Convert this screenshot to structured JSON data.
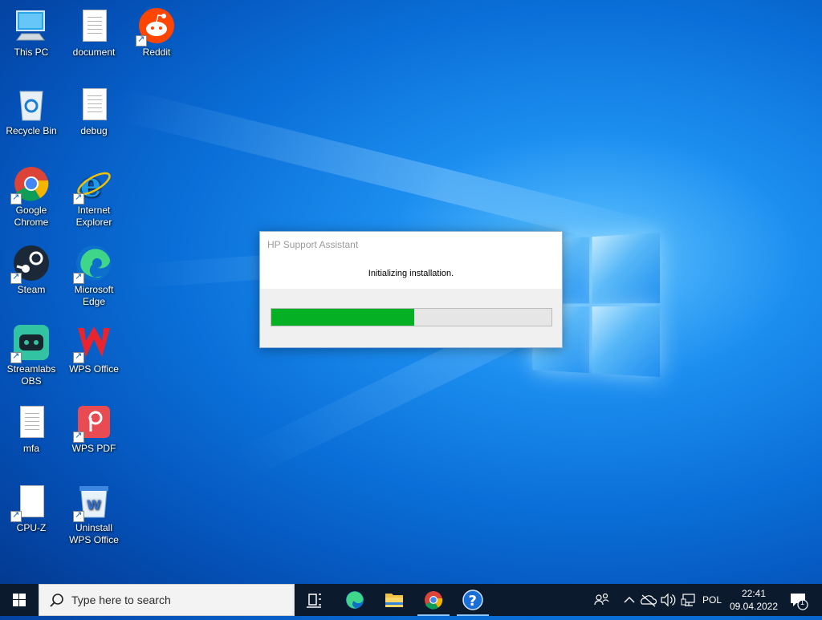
{
  "desktop": {
    "icons": [
      {
        "label": "This PC"
      },
      {
        "label": "document"
      },
      {
        "label": "Reddit"
      },
      {
        "label": "Recycle Bin"
      },
      {
        "label": "debug"
      },
      {
        "label": "Google Chrome"
      },
      {
        "label": "Internet Explorer"
      },
      {
        "label": "Steam"
      },
      {
        "label": "Microsoft Edge"
      },
      {
        "label": "Streamlabs OBS"
      },
      {
        "label": "WPS Office"
      },
      {
        "label": "mfa"
      },
      {
        "label": "WPS PDF"
      },
      {
        "label": "CPU-Z"
      },
      {
        "label": "Uninstall WPS Office"
      }
    ]
  },
  "dialog": {
    "title": "HP Support Assistant",
    "message": "Initializing installation.",
    "progress_fraction": 0.51,
    "progress_color": "#06b025"
  },
  "taskbar": {
    "search_placeholder": "Type here to search",
    "apps": [
      "task-view",
      "microsoft-edge",
      "file-explorer",
      "google-chrome",
      "help"
    ],
    "tray": {
      "language": "POL",
      "time": "22:41",
      "date": "09.04.2022",
      "notification_count": "1"
    }
  },
  "colors": {
    "taskbar_bg": "#0c1a2e",
    "wallpaper_blue": "#0a6fd8"
  }
}
